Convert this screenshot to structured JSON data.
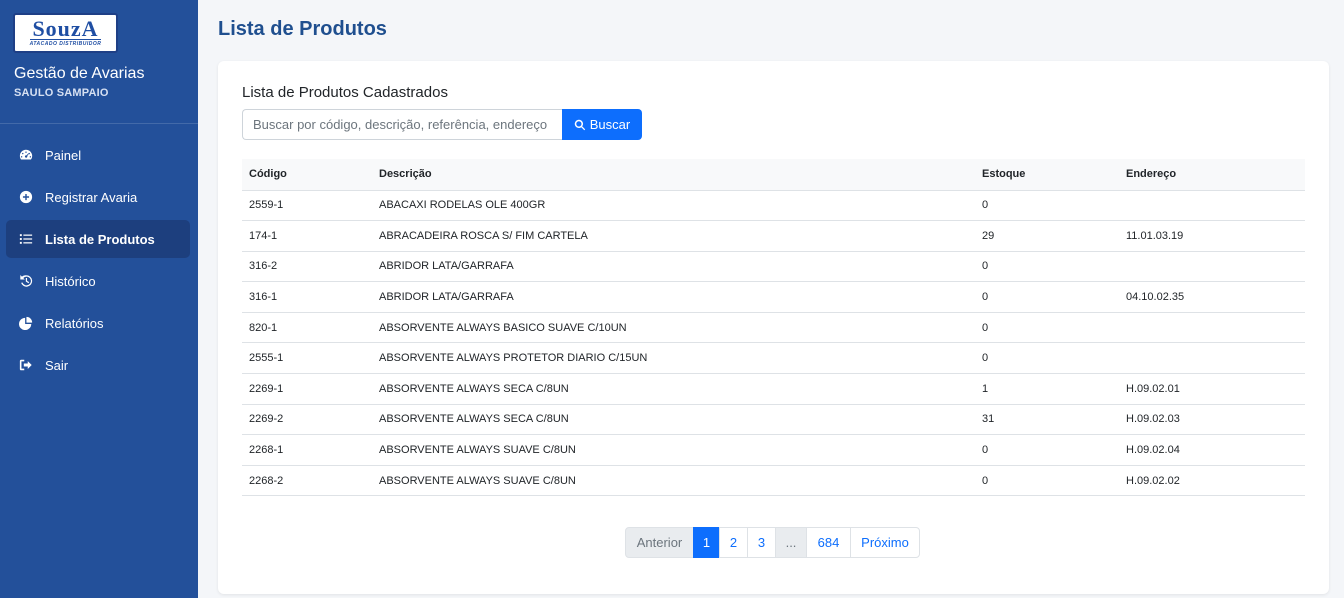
{
  "sidebar": {
    "logo_text": "SouzA",
    "logo_subtext": "ATACADO DISTRIBUIDOR",
    "app_title": "Gestão de Avarias",
    "user_name": "SAULO SAMPAIO",
    "items": [
      {
        "label": "Painel",
        "icon": "dashboard-icon"
      },
      {
        "label": "Registrar Avaria",
        "icon": "plus-circle-icon"
      },
      {
        "label": "Lista de Produtos",
        "icon": "list-icon"
      },
      {
        "label": "Histórico",
        "icon": "history-icon"
      },
      {
        "label": "Relatórios",
        "icon": "pie-chart-icon"
      },
      {
        "label": "Sair",
        "icon": "logout-icon"
      }
    ],
    "active_index": 2
  },
  "header": {
    "title": "Lista de Produtos"
  },
  "card": {
    "title": "Lista de Produtos Cadastrados",
    "search": {
      "placeholder": "Buscar por código, descrição, referência, endereço",
      "button_label": "Buscar"
    },
    "table": {
      "headers": [
        "Código",
        "Descrição",
        "Estoque",
        "Endereço"
      ],
      "rows": [
        [
          "2559-1",
          "ABACAXI RODELAS OLE 400GR",
          "0",
          ""
        ],
        [
          "174-1",
          "ABRACADEIRA ROSCA S/ FIM CARTELA",
          "29",
          "11.01.03.19"
        ],
        [
          "316-2",
          "ABRIDOR LATA/GARRAFA",
          "0",
          ""
        ],
        [
          "316-1",
          "ABRIDOR LATA/GARRAFA",
          "0",
          "04.10.02.35"
        ],
        [
          "820-1",
          "ABSORVENTE ALWAYS BASICO SUAVE C/10UN",
          "0",
          ""
        ],
        [
          "2555-1",
          "ABSORVENTE ALWAYS PROTETOR DIARIO C/15UN",
          "0",
          ""
        ],
        [
          "2269-1",
          "ABSORVENTE ALWAYS SECA C/8UN",
          "1",
          "H.09.02.01"
        ],
        [
          "2269-2",
          "ABSORVENTE ALWAYS SECA C/8UN",
          "31",
          "H.09.02.03"
        ],
        [
          "2268-1",
          "ABSORVENTE ALWAYS SUAVE C/8UN",
          "0",
          "H.09.02.04"
        ],
        [
          "2268-2",
          "ABSORVENTE ALWAYS SUAVE C/8UN",
          "0",
          "H.09.02.02"
        ]
      ]
    },
    "pagination": {
      "previous": "Anterior",
      "pages": [
        "1",
        "2",
        "3",
        "...",
        "684"
      ],
      "current": "1",
      "next": "Próximo"
    }
  },
  "colors": {
    "sidebar_bg": "#23509a",
    "sidebar_active": "#1d3f7e",
    "primary": "#0d6efd",
    "title": "#1f4f8f"
  }
}
